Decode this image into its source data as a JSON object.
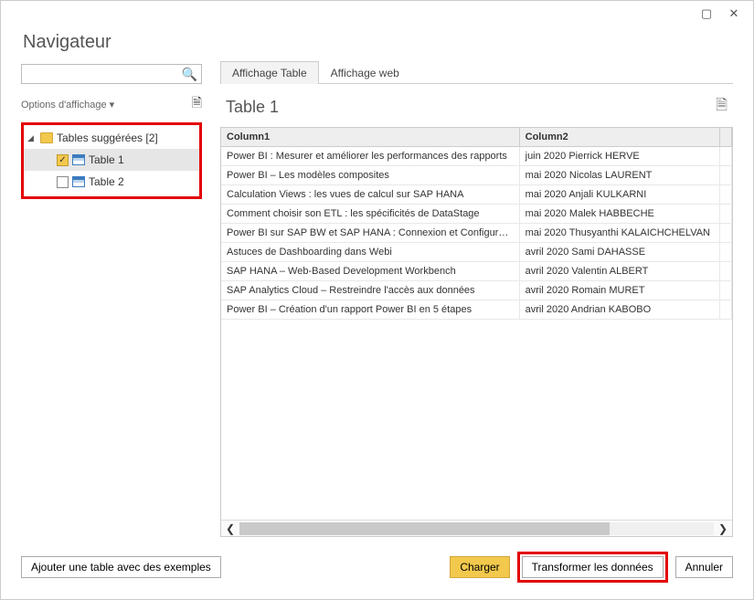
{
  "window": {
    "title": "Navigateur",
    "maximize_label": "▢",
    "close_label": "✕"
  },
  "left": {
    "search_placeholder": "",
    "options_label": "Options d'affichage ▾",
    "group_label": "Tables suggérées [2]",
    "items": [
      {
        "label": "Table 1",
        "checked": true
      },
      {
        "label": "Table 2",
        "checked": false
      }
    ]
  },
  "tabs": {
    "preview": "Affichage Table",
    "web": "Affichage web"
  },
  "table": {
    "title": "Table 1",
    "columns": [
      "Column1",
      "Column2",
      ""
    ],
    "rows": [
      [
        "Power BI : Mesurer et améliorer les performances des rapports",
        "juin 2020 Pierrick HERVE",
        ""
      ],
      [
        "Power BI – Les modèles composites",
        "mai 2020 Nicolas LAURENT",
        ""
      ],
      [
        "Calculation Views : les vues de calcul sur SAP HANA",
        "mai 2020 Anjali KULKARNI",
        ""
      ],
      [
        "Comment choisir son ETL : les spécificités de DataStage",
        "mai 2020 Malek HABBECHE",
        ""
      ],
      [
        "Power BI sur SAP BW et SAP HANA : Connexion et Configuration",
        "mai 2020 Thusyanthi KALAICHCHELVAN",
        ""
      ],
      [
        "Astuces de Dashboarding dans Webi",
        "avril 2020 Sami DAHASSE",
        ""
      ],
      [
        "SAP HANA – Web-Based Development Workbench",
        "avril 2020 Valentin ALBERT",
        ""
      ],
      [
        "SAP Analytics Cloud – Restreindre l'accès aux données",
        "avril 2020 Romain MURET",
        ""
      ],
      [
        "Power BI – Création d'un rapport Power BI en 5 étapes",
        "avril 2020 Andrian KABOBO",
        ""
      ]
    ]
  },
  "footer": {
    "add_table": "Ajouter une table avec des exemples",
    "load": "Charger",
    "transform": "Transformer les données",
    "cancel": "Annuler"
  }
}
